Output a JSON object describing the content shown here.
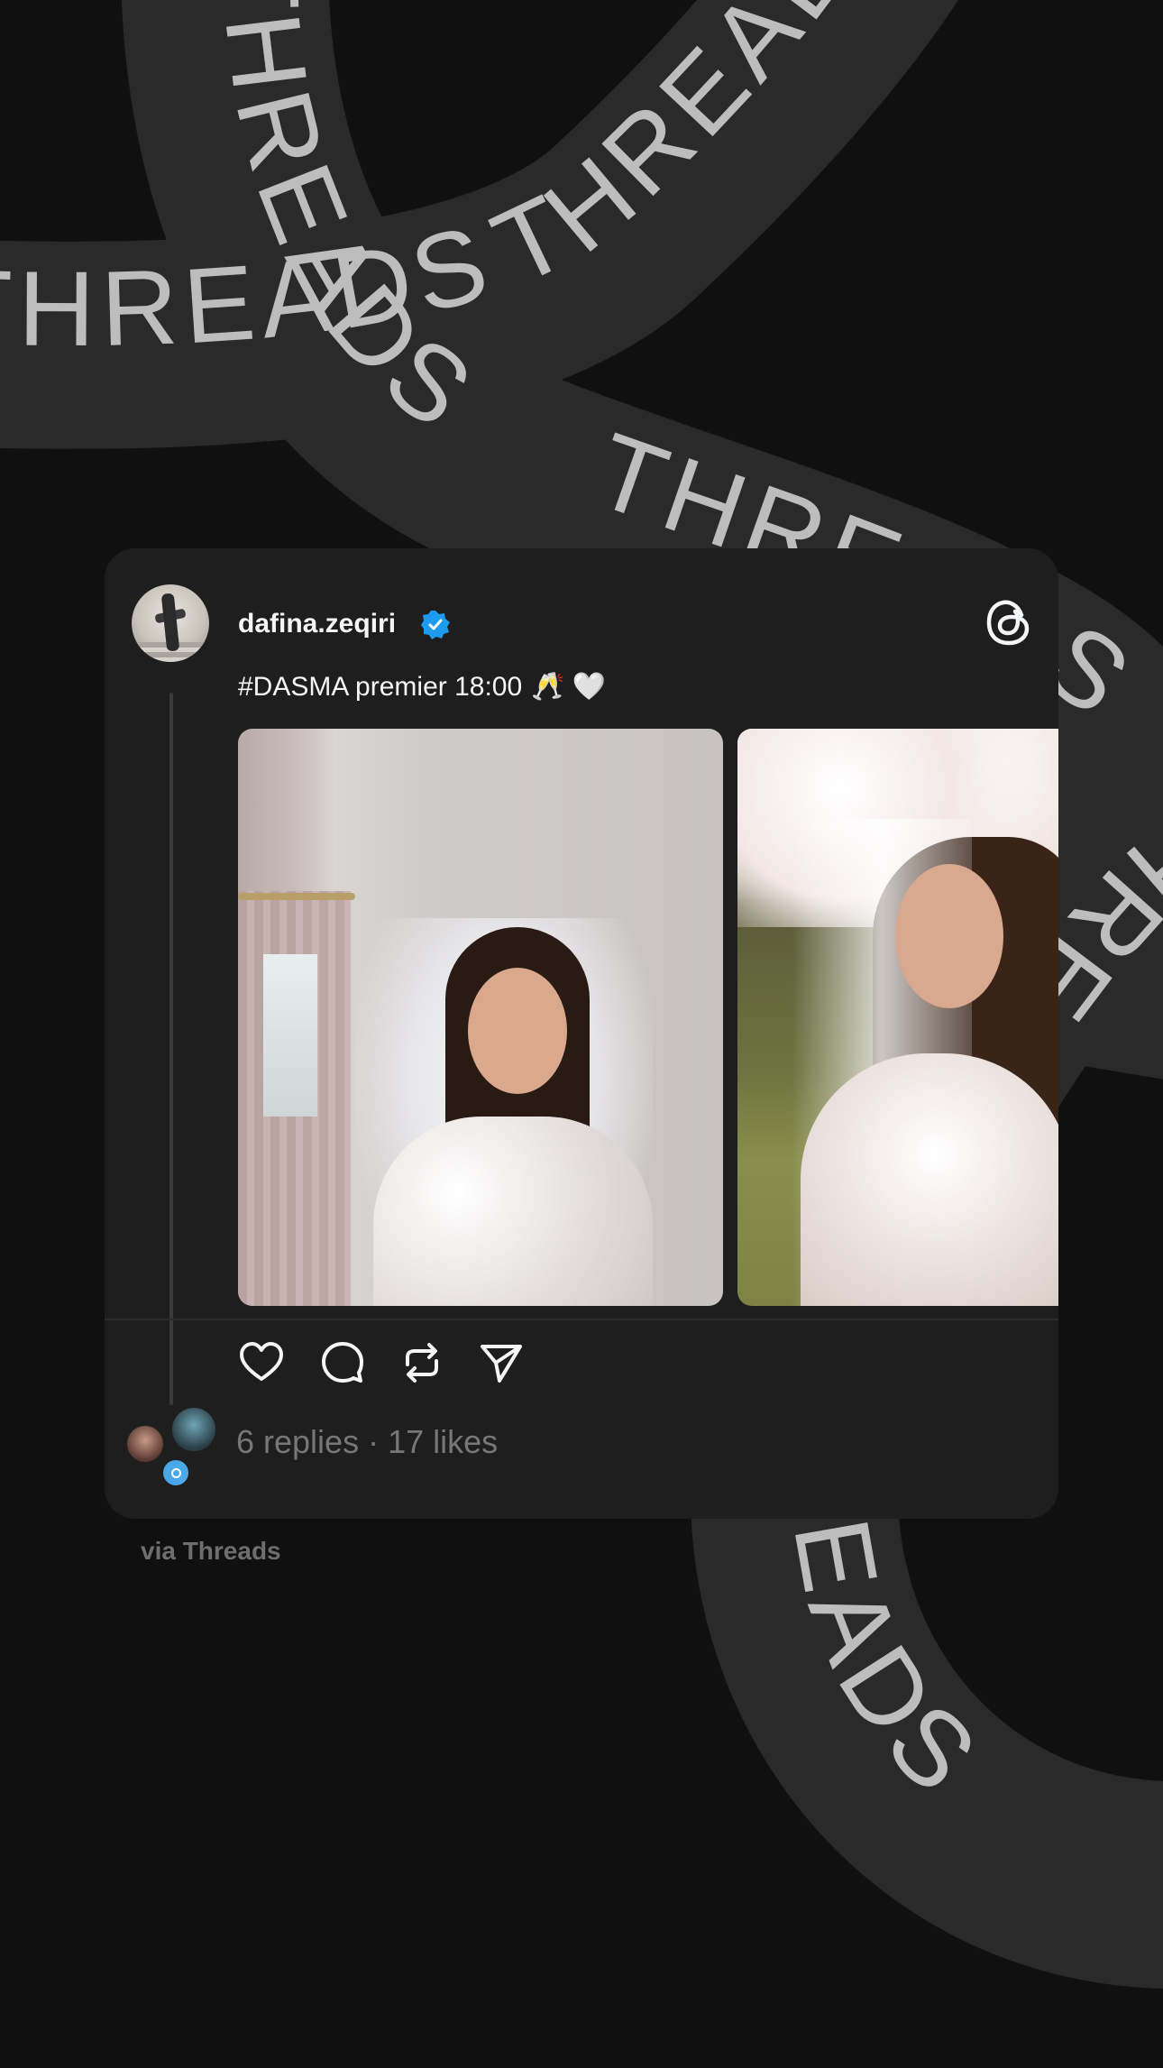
{
  "background": {
    "ribbon_word": "THREADS",
    "ribbon_color": "#2a2a2a",
    "text_color": "#bdbdbd",
    "page_color": "#101010"
  },
  "post": {
    "username": "dafina.zeqiri",
    "verified": true,
    "caption": "#DASMA premier 18:00",
    "caption_emoji": "🥂 🤍",
    "stats": "6 replies · 17 likes",
    "images": [
      "bride-photo-1",
      "bride-photo-2"
    ],
    "card_color": "#1e1e1e"
  },
  "icons": {
    "threads_logo": "threads-logo-icon",
    "like": "heart-icon",
    "reply": "comment-icon",
    "repost": "repost-icon",
    "share": "send-icon",
    "verified": "verified-badge-icon"
  },
  "footer": {
    "via": "via Threads"
  }
}
